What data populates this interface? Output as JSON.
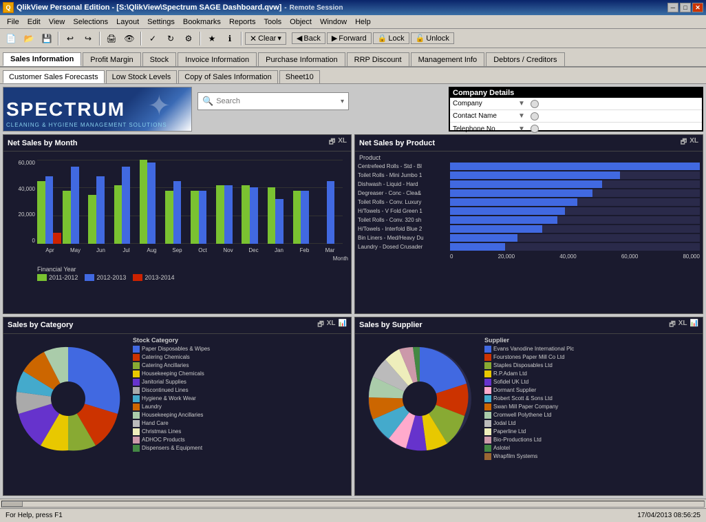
{
  "titleBar": {
    "title": "QlikView Personal Edition - [S:\\QlikView\\Spectrum SAGE Dashboard.qvw]",
    "sessionText": "Remote Session",
    "closeBtn": "✕",
    "maxBtn": "□",
    "minBtn": "─"
  },
  "menuBar": {
    "items": [
      "File",
      "Edit",
      "View",
      "Selections",
      "Layout",
      "Settings",
      "Bookmarks",
      "Reports",
      "Tools",
      "Object",
      "Window",
      "Help"
    ]
  },
  "toolbar": {
    "clearBtn": "Clear",
    "backBtn": "Back",
    "forwardBtn": "Forward",
    "lockBtn": "Lock",
    "unlockBtn": "Unlock"
  },
  "tabs1": {
    "items": [
      "Sales Information",
      "Profit Margin",
      "Stock",
      "Invoice Information",
      "Purchase Information",
      "RRP Discount",
      "Management Info",
      "Debtors / Creditors"
    ],
    "activeIndex": 0
  },
  "tabs2": {
    "items": [
      "Customer Sales Forecasts",
      "Low Stock Levels",
      "Copy of Sales Information",
      "Sheet10"
    ],
    "activeIndex": 0
  },
  "logo": {
    "brand": "SPECTRUM",
    "tagline": "CLEANING & HYGIENE MANAGEMENT SOLUTIONS"
  },
  "search": {
    "placeholder": "Search"
  },
  "companyDetails": {
    "title": "Company Details",
    "fields": [
      {
        "label": "Company",
        "hasArrow": true
      },
      {
        "label": "Contact Name",
        "hasArrow": true
      },
      {
        "label": "Telephone No",
        "hasArrow": true
      }
    ]
  },
  "netSalesByMonth": {
    "title": "Net Sales by Month",
    "yAxisLabels": [
      "0",
      "20,000",
      "40,000",
      "60,000"
    ],
    "xAxisLabel": "Month",
    "months": [
      "Apr",
      "May",
      "Jun",
      "Jul",
      "Aug",
      "Sep",
      "Oct",
      "Nov",
      "Dec",
      "Jan",
      "Feb",
      "Mar"
    ],
    "fyLabel": "Financial Year",
    "legend": [
      {
        "label": "2011-2012",
        "color": "#7ac231"
      },
      {
        "label": "2012-2013",
        "color": "#4169e1"
      },
      {
        "label": "2013-2014",
        "color": "#cc2200"
      }
    ],
    "data": {
      "2011_2012": [
        45,
        38,
        35,
        42,
        60,
        38,
        38,
        42,
        42,
        40,
        38,
        0
      ],
      "2012_2013": [
        48,
        55,
        48,
        55,
        58,
        45,
        38,
        42,
        40,
        32,
        38,
        45
      ],
      "2013_2014": [
        8,
        0,
        0,
        0,
        0,
        0,
        0,
        0,
        0,
        0,
        0,
        0
      ]
    }
  },
  "netSalesByProduct": {
    "title": "Net Sales by Product",
    "headerLabel": "Product",
    "products": [
      {
        "name": "Centrefeed Rolls - Std - Bl",
        "value": 82000,
        "pct": 100
      },
      {
        "name": "Toilet Rolls - Mini Jumbo 1",
        "value": 56000,
        "pct": 68
      },
      {
        "name": "Dishwash - Liquid - Hard",
        "value": 50000,
        "pct": 61
      },
      {
        "name": "Degreaser - Conc - Clea&",
        "value": 47000,
        "pct": 57
      },
      {
        "name": "Toilet Rolls - Conv. Luxury",
        "value": 42000,
        "pct": 51
      },
      {
        "name": "H/Towels - V Fold Green 1",
        "value": 38000,
        "pct": 46
      },
      {
        "name": "Toilet Rolls - Conv. 320 sh",
        "value": 35000,
        "pct": 43
      },
      {
        "name": "H/Towels - Interfold Blue 2",
        "value": 30000,
        "pct": 37
      },
      {
        "name": "Bin Liners - Med/Heavy Du",
        "value": 22000,
        "pct": 27
      },
      {
        "name": "Laundry - Dosed Crusader",
        "value": 18000,
        "pct": 22
      }
    ],
    "axisLabels": [
      "0",
      "20,000",
      "40,000",
      "60,000",
      "80,000"
    ]
  },
  "salesByCategory": {
    "title": "Sales by Category",
    "legendTitle": "Stock Category",
    "categories": [
      {
        "label": "Paper Disposables & Wipes",
        "color": "#4169e1"
      },
      {
        "label": "Catering Chemicals",
        "color": "#cc3300"
      },
      {
        "label": "Catering Ancillaries",
        "color": "#88aa33"
      },
      {
        "label": "Housekeeping Chemicals",
        "color": "#e8c800"
      },
      {
        "label": "Janitorial Supplies",
        "color": "#6633cc"
      },
      {
        "label": "Discontinued Lines",
        "color": "#aaaaaa"
      },
      {
        "label": "Hygiene & Work Wear",
        "color": "#44aacc"
      },
      {
        "label": "Laundry",
        "color": "#cc6600"
      },
      {
        "label": "Housekeeping Ancillaries",
        "color": "#aaccaa"
      },
      {
        "label": "Hand Care",
        "color": "#bbbbbb"
      },
      {
        "label": "Christmas Lines",
        "color": "#eeeebb"
      },
      {
        "label": "ADHOC Products",
        "color": "#cc99aa"
      },
      {
        "label": "Dispensers & Equipment",
        "color": "#448844"
      }
    ]
  },
  "salesBySupplier": {
    "title": "Sales by Supplier",
    "legendTitle": "Supplier",
    "suppliers": [
      {
        "label": "Evans Vanodine International Plc",
        "color": "#4169e1"
      },
      {
        "label": "Fourstones Paper Mill Co Ltd",
        "color": "#cc3300"
      },
      {
        "label": "Staples Disposables Ltd",
        "color": "#88aa33"
      },
      {
        "label": "R.P.Adam Ltd",
        "color": "#e8c800"
      },
      {
        "label": "Sofidel UK Ltd",
        "color": "#6633cc"
      },
      {
        "label": "Dormant Supplier",
        "color": "#ffaacc"
      },
      {
        "label": "Robert Scott & Sons Ltd",
        "color": "#44aacc"
      },
      {
        "label": "Swan Mill Paper Company",
        "color": "#cc6600"
      },
      {
        "label": "Cromwell Polythene Ltd",
        "color": "#aaccaa"
      },
      {
        "label": "Jodal Ltd",
        "color": "#bbbbbb"
      },
      {
        "label": "Paperline Ltd",
        "color": "#eeeebb"
      },
      {
        "label": "Bio-Productions Ltd",
        "color": "#cc99aa"
      },
      {
        "label": "Aslotel",
        "color": "#448844"
      },
      {
        "label": "Wrapfilm Systems",
        "color": "#996633"
      }
    ]
  },
  "statusBar": {
    "helpText": "For Help, press F1",
    "datetime": "17/04/2013  08:56:25"
  }
}
